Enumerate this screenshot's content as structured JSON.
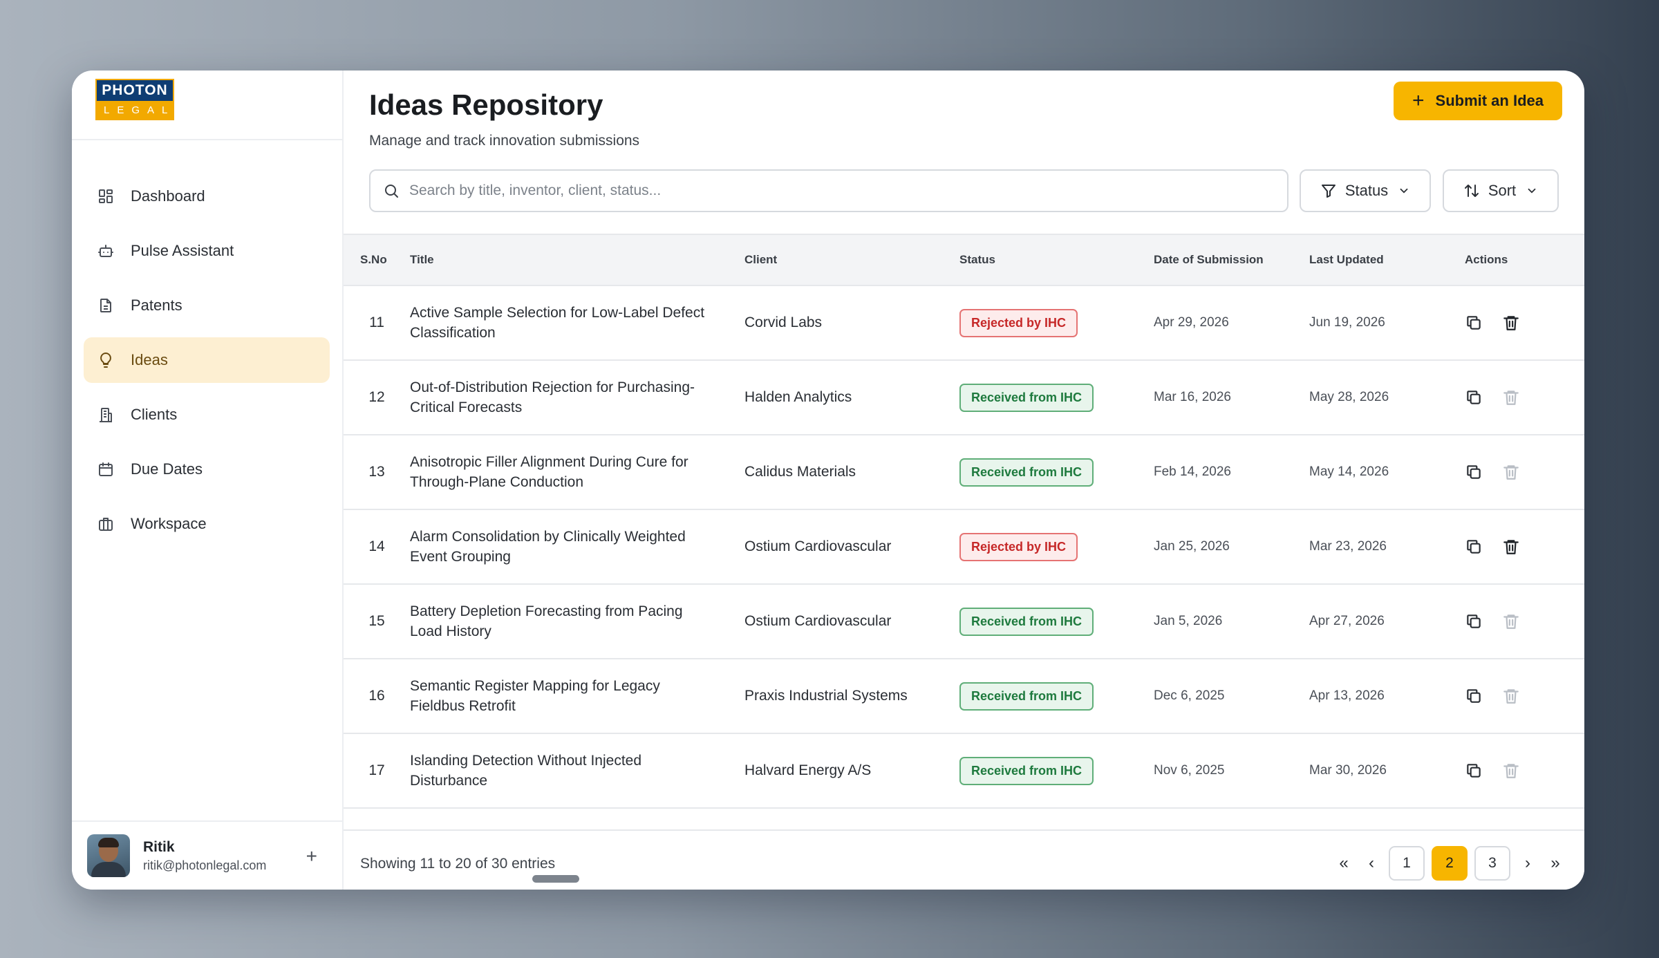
{
  "brand": {
    "line1": "PHOTON",
    "line2": "LEGAL"
  },
  "nav": [
    {
      "label": "Dashboard",
      "icon": "dashboard-icon",
      "active": false
    },
    {
      "label": "Pulse Assistant",
      "icon": "bot-icon",
      "active": false
    },
    {
      "label": "Patents",
      "icon": "document-icon",
      "active": false
    },
    {
      "label": "Ideas",
      "icon": "lightbulb-icon",
      "active": true
    },
    {
      "label": "Clients",
      "icon": "building-icon",
      "active": false
    },
    {
      "label": "Due Dates",
      "icon": "calendar-icon",
      "active": false
    },
    {
      "label": "Workspace",
      "icon": "briefcase-icon",
      "active": false
    }
  ],
  "user": {
    "name": "Ritik",
    "email": "ritik@photonlegal.com"
  },
  "header": {
    "title": "Ideas Repository",
    "subtitle": "Manage and track innovation submissions",
    "submit_label": "Submit an Idea"
  },
  "search": {
    "placeholder": "Search by title, inventor, client, status..."
  },
  "filters": {
    "status_label": "Status",
    "sort_label": "Sort"
  },
  "table": {
    "columns": [
      "S.No",
      "Title",
      "Client",
      "Status",
      "Date of Submission",
      "Last Updated",
      "Actions"
    ],
    "rows": [
      {
        "sno": "11",
        "title": "Active Sample Selection for Low-Label Defect Classification",
        "client": "Corvid Labs",
        "status": "Rejected by IHC",
        "submitted": "Apr 29, 2026",
        "updated": "Jun 19, 2026",
        "delete_enabled": true
      },
      {
        "sno": "12",
        "title": "Out-of-Distribution Rejection for Purchasing-Critical Forecasts",
        "client": "Halden Analytics",
        "status": "Received from IHC",
        "submitted": "Mar 16, 2026",
        "updated": "May 28, 2026",
        "delete_enabled": false
      },
      {
        "sno": "13",
        "title": "Anisotropic Filler Alignment During Cure for Through-Plane Conduction",
        "client": "Calidus Materials",
        "status": "Received from IHC",
        "submitted": "Feb 14, 2026",
        "updated": "May 14, 2026",
        "delete_enabled": false
      },
      {
        "sno": "14",
        "title": "Alarm Consolidation by Clinically Weighted Event Grouping",
        "client": "Ostium Cardiovascular",
        "status": "Rejected by IHC",
        "submitted": "Jan 25, 2026",
        "updated": "Mar 23, 2026",
        "delete_enabled": true
      },
      {
        "sno": "15",
        "title": "Battery Depletion Forecasting from Pacing Load History",
        "client": "Ostium Cardiovascular",
        "status": "Received from IHC",
        "submitted": "Jan 5, 2026",
        "updated": "Apr 27, 2026",
        "delete_enabled": false
      },
      {
        "sno": "16",
        "title": "Semantic Register Mapping for Legacy Fieldbus Retrofit",
        "client": "Praxis Industrial Systems",
        "status": "Received from IHC",
        "submitted": "Dec 6, 2025",
        "updated": "Apr 13, 2026",
        "delete_enabled": false
      },
      {
        "sno": "17",
        "title": "Islanding Detection Without Injected Disturbance",
        "client": "Halvard Energy A/S",
        "status": "Received from IHC",
        "submitted": "Nov 6, 2025",
        "updated": "Mar 30, 2026",
        "delete_enabled": false
      }
    ]
  },
  "footer": {
    "info": "Showing 11 to 20 of 30 entries",
    "pages": [
      "1",
      "2",
      "3"
    ],
    "current_page": "2",
    "first": "«",
    "prev": "‹",
    "next": "›",
    "last": "»"
  },
  "colors": {
    "accent": "#f7b500",
    "rejected": "#c62828",
    "received": "#1e7a3e"
  }
}
